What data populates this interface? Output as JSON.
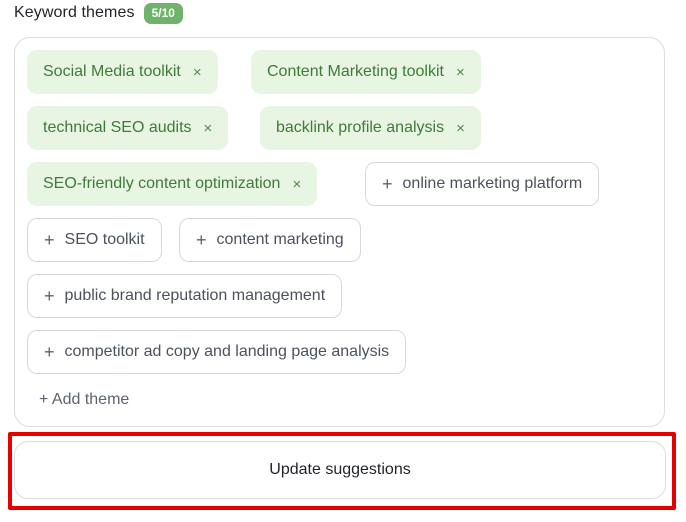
{
  "header": {
    "title": "Keyword themes",
    "count_badge": "5/10"
  },
  "selected_themes": [
    {
      "label": "Social Media toolkit",
      "remove_icon": "×"
    },
    {
      "label": "Content Marketing toolkit",
      "remove_icon": "×"
    },
    {
      "label": "technical SEO audits",
      "remove_icon": "×"
    },
    {
      "label": "backlink profile analysis",
      "remove_icon": "×"
    },
    {
      "label": "SEO-friendly content optimization",
      "remove_icon": "×"
    }
  ],
  "suggested_themes": [
    {
      "label": "online marketing platform",
      "add_icon": "+"
    },
    {
      "label": "SEO toolkit",
      "add_icon": "+"
    },
    {
      "label": "content marketing",
      "add_icon": "+"
    },
    {
      "label": "public brand reputation management",
      "add_icon": "+"
    },
    {
      "label": "competitor ad copy and landing page analysis",
      "add_icon": "+"
    }
  ],
  "add_theme_label": "+ Add theme",
  "update_button_label": "Update suggestions",
  "colors": {
    "badge": "#6fb36a",
    "selected_chip_bg": "#e8f5e3",
    "selected_chip_text": "#3f7a39",
    "highlight": "#e60000"
  }
}
